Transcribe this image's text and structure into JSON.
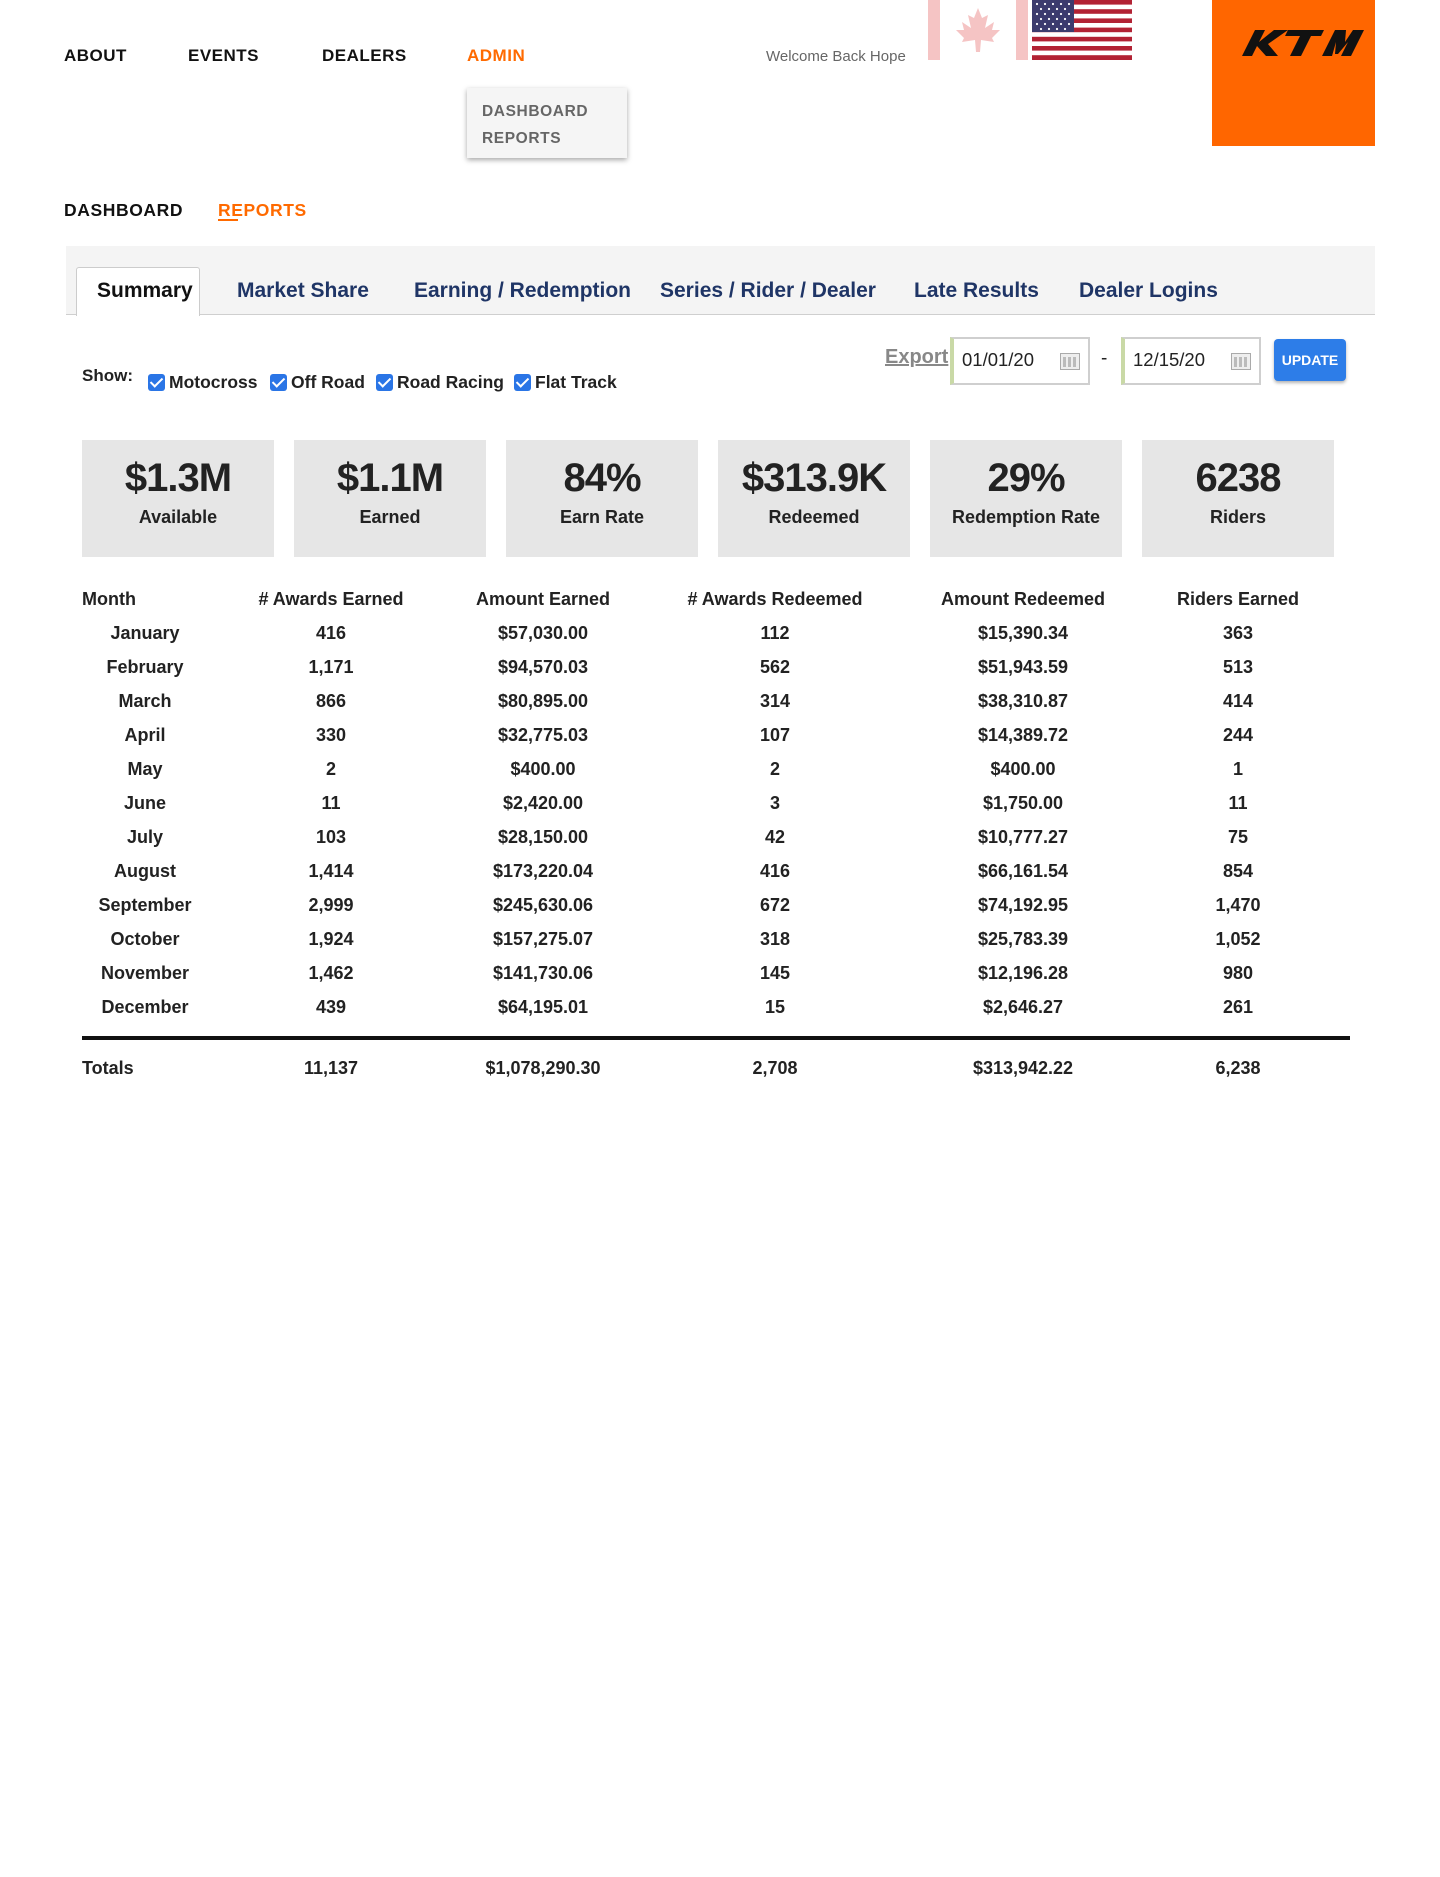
{
  "topnav": {
    "items": [
      "ABOUT",
      "EVENTS",
      "DEALERS",
      "ADMIN"
    ],
    "welcome": "Welcome Back Hope"
  },
  "admin_menu": [
    "DASHBOARD",
    "REPORTS"
  ],
  "subnav": [
    "DASHBOARD",
    "REPORTS"
  ],
  "brand": {
    "accent": "#ff6600",
    "tab_text": "#1f3566",
    "update_button": "#2d7de8"
  },
  "tabs": [
    "Summary",
    "Market Share",
    "Earning / Redemption",
    "Series / Rider / Dealer",
    "Late Results",
    "Dealer Logins"
  ],
  "filters": {
    "show_label": "Show:",
    "options": [
      {
        "label": "Motocross",
        "checked": true
      },
      {
        "label": "Off Road",
        "checked": true
      },
      {
        "label": "Road Racing",
        "checked": true
      },
      {
        "label": "Flat Track",
        "checked": true
      }
    ],
    "export_label": "Export",
    "start_date": "01/01/20",
    "separator": "-",
    "end_date": "12/15/20",
    "update_label": "UPDATE"
  },
  "stats": [
    {
      "value": "$1.3M",
      "label": "Available"
    },
    {
      "value": "$1.1M",
      "label": "Earned"
    },
    {
      "value": "84%",
      "label": "Earn Rate"
    },
    {
      "value": "$313.9K",
      "label": "Redeemed"
    },
    {
      "value": "29%",
      "label": "Redemption Rate"
    },
    {
      "value": "6238",
      "label": "Riders"
    }
  ],
  "table": {
    "headers": [
      "Month",
      "# Awards Earned",
      "Amount Earned",
      "# Awards Redeemed",
      "Amount Redeemed",
      "Riders Earned"
    ],
    "rows": [
      [
        "January",
        "416",
        "$57,030.00",
        "112",
        "$15,390.34",
        "363"
      ],
      [
        "February",
        "1,171",
        "$94,570.03",
        "562",
        "$51,943.59",
        "513"
      ],
      [
        "March",
        "866",
        "$80,895.00",
        "314",
        "$38,310.87",
        "414"
      ],
      [
        "April",
        "330",
        "$32,775.03",
        "107",
        "$14,389.72",
        "244"
      ],
      [
        "May",
        "2",
        "$400.00",
        "2",
        "$400.00",
        "1"
      ],
      [
        "June",
        "11",
        "$2,420.00",
        "3",
        "$1,750.00",
        "11"
      ],
      [
        "July",
        "103",
        "$28,150.00",
        "42",
        "$10,777.27",
        "75"
      ],
      [
        "August",
        "1,414",
        "$173,220.04",
        "416",
        "$66,161.54",
        "854"
      ],
      [
        "September",
        "2,999",
        "$245,630.06",
        "672",
        "$74,192.95",
        "1,470"
      ],
      [
        "October",
        "1,924",
        "$157,275.07",
        "318",
        "$25,783.39",
        "1,052"
      ],
      [
        "November",
        "1,462",
        "$141,730.06",
        "145",
        "$12,196.28",
        "980"
      ],
      [
        "December",
        "439",
        "$64,195.01",
        "15",
        "$2,646.27",
        "261"
      ]
    ],
    "totals": [
      "Totals",
      "11,137",
      "$1,078,290.30",
      "2,708",
      "$313,942.22",
      "6,238"
    ]
  }
}
